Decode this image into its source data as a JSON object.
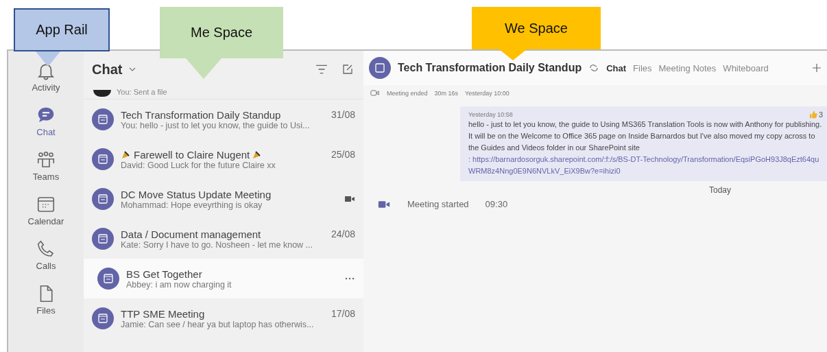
{
  "callouts": [
    {
      "label": "App Rail",
      "color": "#b4c7e7"
    },
    {
      "label": "Me Space",
      "color": "#c5e0b4"
    },
    {
      "label": "We Space",
      "color": "#ffc000"
    }
  ],
  "app_rail": [
    {
      "label": "Activity",
      "kind": "bell",
      "selected": false
    },
    {
      "label": "Chat",
      "kind": "chat",
      "selected": true
    },
    {
      "label": "Teams",
      "kind": "teams",
      "selected": false
    },
    {
      "label": "Calendar",
      "kind": "calendar",
      "selected": false
    },
    {
      "label": "Calls",
      "kind": "phone",
      "selected": false
    },
    {
      "label": "Files",
      "kind": "file",
      "selected": false
    }
  ],
  "chat_list": {
    "title": "Chat",
    "partial_preview": "You: Sent a file",
    "items": [
      {
        "title": "Tech Transformation Daily Standup",
        "preview": "You: hello - just to let you know, the guide to Usi...",
        "date": "31/08",
        "decorated": false,
        "kind": "plain",
        "selected": false
      },
      {
        "title": "Farewell to Claire Nugent",
        "preview": "David: Good Luck for the future Claire xx",
        "date": "25/08",
        "decorated": true,
        "kind": "plain",
        "selected": false
      },
      {
        "title": "DC Move Status Update Meeting",
        "preview": "Mohammad: Hope eveyrthing is okay",
        "kind": "video",
        "decorated": false,
        "selected": false
      },
      {
        "title": "Data / Document management",
        "preview": "Kate: Sorry I have to go. Nosheen - let me know ...",
        "date": "24/08",
        "decorated": false,
        "kind": "plain",
        "selected": false
      },
      {
        "title": "BS Get Together",
        "preview": "Abbey: i am now charging it",
        "kind": "more",
        "decorated": false,
        "selected": true
      },
      {
        "title": "TTP SME Meeting",
        "preview": "Jamie: Can see / hear ya but laptop has otherwis...",
        "date": "17/08",
        "decorated": false,
        "kind": "plain",
        "selected": false
      }
    ]
  },
  "conversation": {
    "title": "Tech Transformation Daily Standup",
    "tabs": [
      {
        "label": "Chat",
        "selected": true
      },
      {
        "label": "Files",
        "selected": false
      },
      {
        "label": "Meeting Notes",
        "selected": false
      },
      {
        "label": "Whiteboard",
        "selected": false
      }
    ],
    "meeting_ended": {
      "label": "Meeting ended",
      "duration": "30m 16s",
      "time": "Yesterday 10:00"
    },
    "message": {
      "time": "Yesterday 10:58",
      "text": "hello - just to let you know, the guide to Using MS365 Translation Tools is now with Anthony for publishing. It will be on the Welcome to Office 365 page on Inside Barnardos but I've also moved my copy across to the Guides and Videos folder in  our SharePoint site",
      "link": ": https://barnardosorguk.sharepoint.com/:f:/s/BS-DT-Technology/Transformation/EqsiPGoH93J8qEzt64quWRM8z4Nng0E9N6NVLkV_EiX9Bw?e=ihizi0",
      "reaction_count": "3"
    },
    "divider": "Today",
    "meeting_started": {
      "label": "Meeting started",
      "time": "09:30"
    }
  }
}
